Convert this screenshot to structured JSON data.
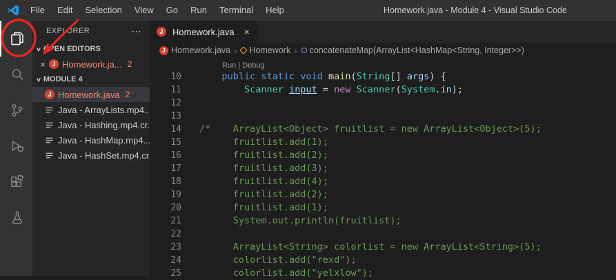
{
  "title_bar": {
    "title": "Homework.java - Module 4 - Visual Studio Code",
    "menus": [
      "File",
      "Edit",
      "Selection",
      "View",
      "Go",
      "Run",
      "Terminal",
      "Help"
    ]
  },
  "icons": {
    "close": "×",
    "ellipsis": "⋯",
    "chevron_down": "∨",
    "breadcrumb_separator": "›",
    "java_letter": "J",
    "activity_bar": [
      "files-icon",
      "search-icon",
      "source-control-icon",
      "run-debug-icon",
      "extensions-icon",
      "testing-icon"
    ]
  },
  "annotation": {
    "color": "#e8261f"
  },
  "colors": {
    "error_file_label": "#f48771",
    "activity_bar_bg": "#333333",
    "sidebar_bg": "#252526",
    "editor_bg": "#1e1e1e",
    "titlebar_bg": "#323233"
  },
  "sidebar": {
    "header": "EXPLORER",
    "sections": [
      {
        "label": "OPEN EDITORS",
        "items": [
          {
            "label": "Homework.ja...",
            "badge": "2",
            "icon": "java",
            "close": true,
            "status": "error"
          }
        ]
      },
      {
        "label": "MODULE 4",
        "items": [
          {
            "label": "Homework.java",
            "badge": "2",
            "icon": "java",
            "selected": true,
            "status": "error"
          },
          {
            "label": "Java - ArrayLists.mp4...",
            "icon": "list"
          },
          {
            "label": "Java - Hashing.mp4.cr...",
            "icon": "list"
          },
          {
            "label": "Java - HashMap.mp4...",
            "icon": "list"
          },
          {
            "label": "Java - HashSet.mp4.cr...",
            "icon": "list"
          }
        ]
      }
    ]
  },
  "editor": {
    "tab": {
      "label": "Homework.java"
    },
    "breadcrumbs": [
      {
        "icon": "java",
        "label": "Homework.java"
      },
      {
        "icon": "class",
        "label": "Homework"
      },
      {
        "icon": "method",
        "label": "concatenateMap(ArrayList<HashMap<String, Integer>>)"
      }
    ],
    "code_lines": [
      {
        "lens": "Run | Debug"
      },
      {
        "n": "10",
        "t": [
          [
            "p",
            "    "
          ],
          [
            "k",
            "public"
          ],
          [
            "p",
            " "
          ],
          [
            "k",
            "static"
          ],
          [
            "p",
            " "
          ],
          [
            "k",
            "void"
          ],
          [
            "p",
            " "
          ],
          [
            "f",
            "main"
          ],
          [
            "p",
            "("
          ],
          [
            "y",
            "String"
          ],
          [
            "p",
            "[] "
          ],
          [
            "v",
            "args"
          ],
          [
            "p",
            ") {"
          ]
        ]
      },
      {
        "n": "11",
        "t": [
          [
            "p",
            "        "
          ],
          [
            "y",
            "Scanner"
          ],
          [
            "p",
            " "
          ],
          [
            "u",
            "input"
          ],
          [
            "p",
            " = "
          ],
          [
            "n",
            "new"
          ],
          [
            "p",
            " "
          ],
          [
            "y",
            "Scanner"
          ],
          [
            "p",
            "("
          ],
          [
            "y",
            "System"
          ],
          [
            "p",
            "."
          ],
          [
            "v",
            "in"
          ],
          [
            "p",
            ");"
          ]
        ]
      },
      {
        "n": "12",
        "t": []
      },
      {
        "n": "13",
        "t": []
      },
      {
        "n": "14",
        "t": [
          [
            "c",
            "/*    ArrayList<Object> fruitlist = new ArrayList<Object>(5);"
          ]
        ]
      },
      {
        "n": "15",
        "t": [
          [
            "c",
            "      fruitlist.add(1);"
          ]
        ]
      },
      {
        "n": "16",
        "t": [
          [
            "c",
            "      fruitlist.add(2);"
          ]
        ]
      },
      {
        "n": "17",
        "t": [
          [
            "c",
            "      fruitlist.add(3);"
          ]
        ]
      },
      {
        "n": "18",
        "t": [
          [
            "c",
            "      fruitlist.add(4);"
          ]
        ]
      },
      {
        "n": "19",
        "t": [
          [
            "c",
            "      fruitlist.add(2);"
          ]
        ]
      },
      {
        "n": "20",
        "t": [
          [
            "c",
            "      fruitlist.add(1);"
          ]
        ]
      },
      {
        "n": "21",
        "t": [
          [
            "c",
            "      System.out.println(fruitlist);"
          ]
        ]
      },
      {
        "n": "22",
        "t": []
      },
      {
        "n": "23",
        "t": [
          [
            "c",
            "      ArrayList<String> colorlist = new ArrayList<String>(5);"
          ]
        ]
      },
      {
        "n": "24",
        "t": [
          [
            "c",
            "      colorlist.add(\"rexd\");"
          ]
        ]
      },
      {
        "n": "25",
        "t": [
          [
            "c",
            "      colorlist.add(\"yelxlow\");"
          ]
        ]
      }
    ]
  }
}
